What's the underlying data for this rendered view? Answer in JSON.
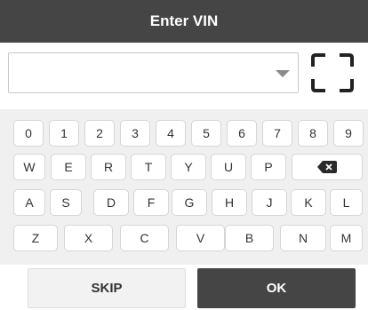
{
  "dialog": {
    "title": "Enter VIN"
  },
  "vin_input": {
    "value": "",
    "placeholder": ""
  },
  "keyboard": {
    "row1": [
      "0",
      "1",
      "2",
      "3",
      "4",
      "5",
      "6",
      "7",
      "8",
      "9"
    ],
    "row2": [
      "W",
      "E",
      "R",
      "T",
      "Y",
      "U",
      "P"
    ],
    "row3": [
      "A",
      "S",
      "D",
      "F",
      "G",
      "H",
      "J",
      "K",
      "L"
    ],
    "row4": [
      "Z",
      "X",
      "C",
      "V",
      "B",
      "N",
      "M"
    ],
    "backspace_icon": "backspace-icon"
  },
  "buttons": {
    "skip": "SKIP",
    "ok": "OK"
  },
  "colors": {
    "title_bar": "#454545",
    "ok_button": "#454545",
    "keyboard_bg": "#f0f0f0"
  }
}
